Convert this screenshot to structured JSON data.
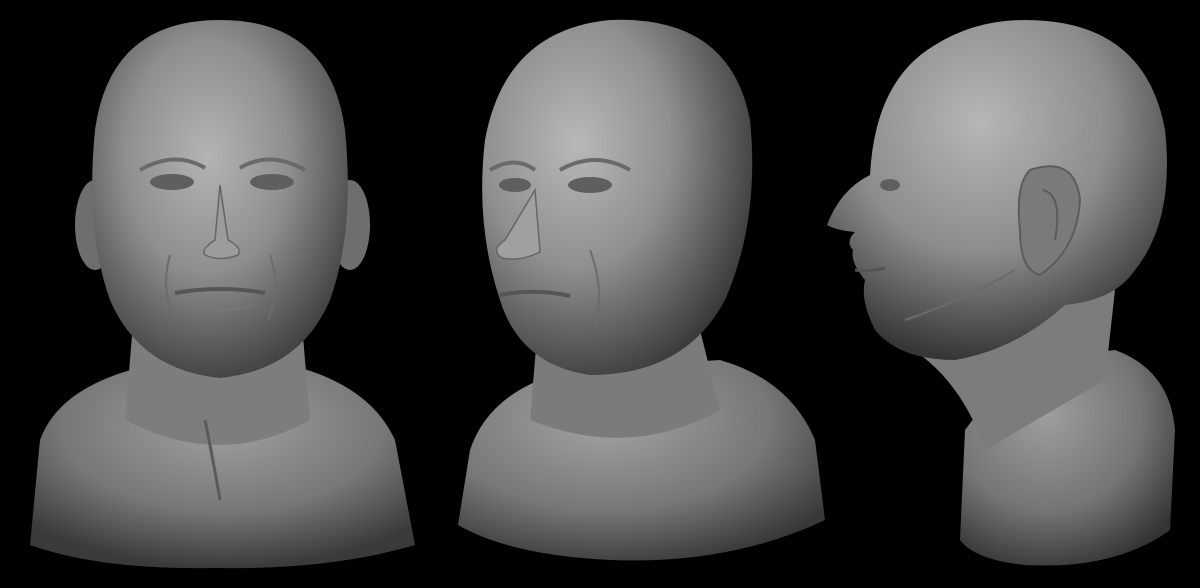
{
  "scene": {
    "background_color": "#000000",
    "clay_color": "#8a8a8a",
    "views": [
      {
        "angle": "front",
        "icon": "sculpted-bust-front"
      },
      {
        "angle": "three-quarter",
        "icon": "sculpted-bust-three-quarter"
      },
      {
        "angle": "profile",
        "icon": "sculpted-bust-profile"
      }
    ]
  }
}
